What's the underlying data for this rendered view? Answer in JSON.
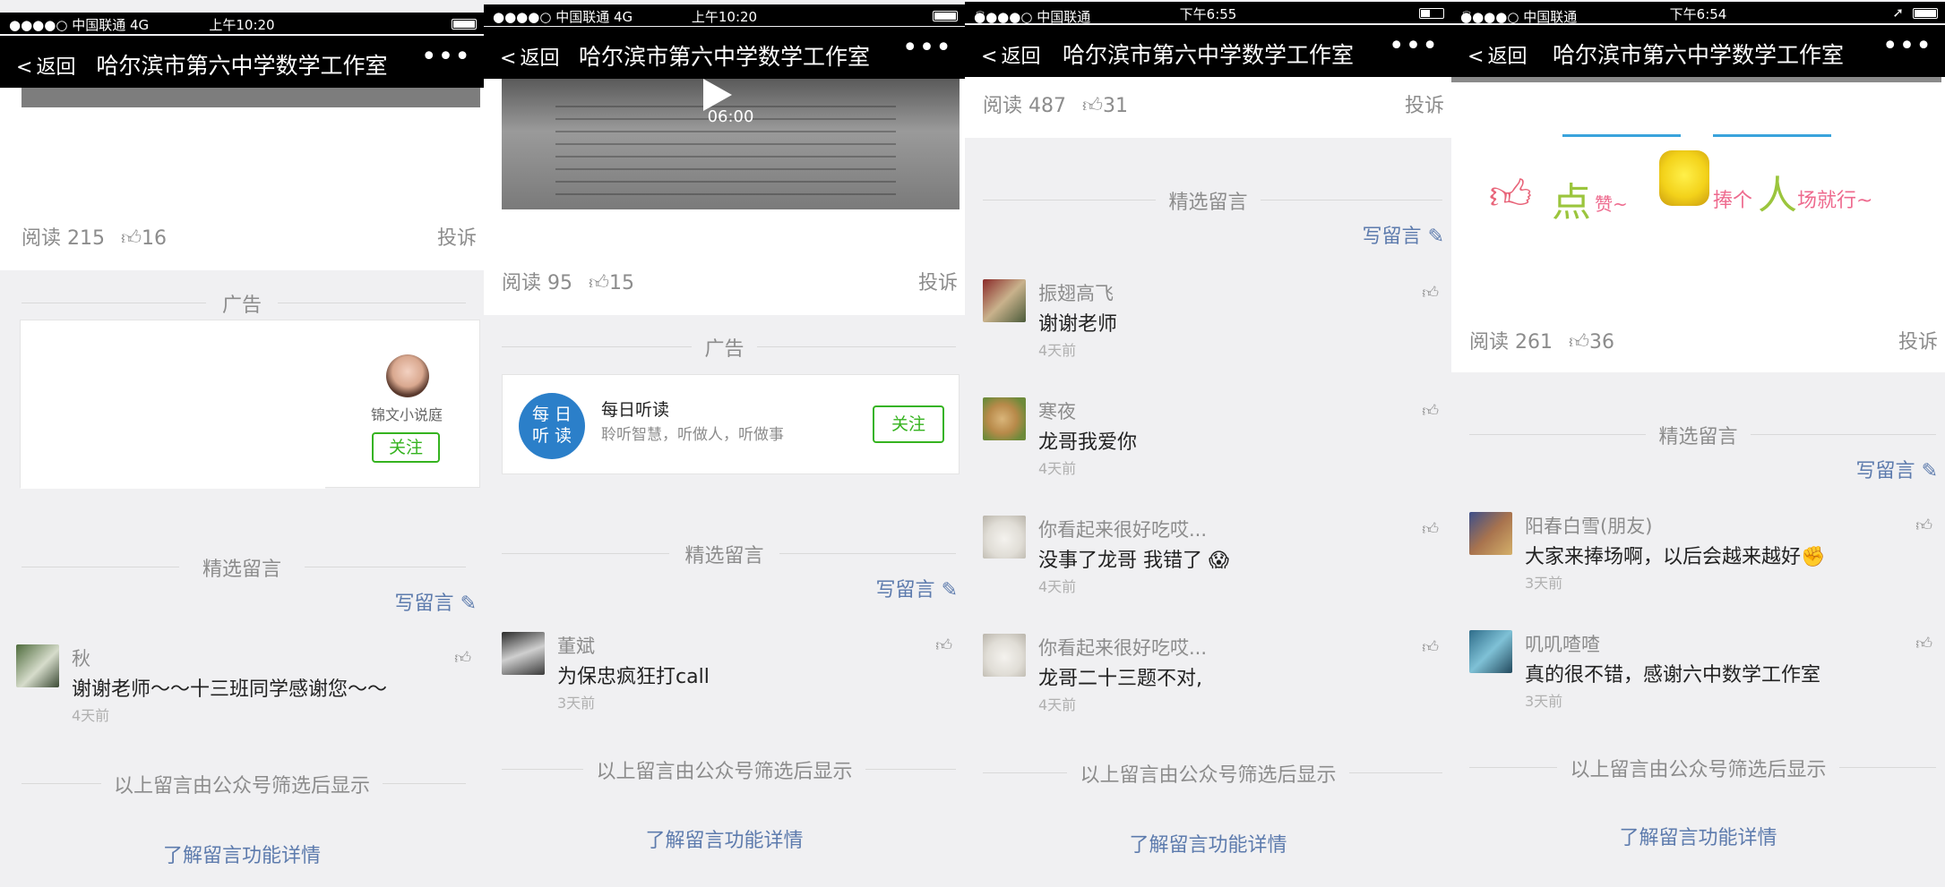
{
  "panels": [
    {
      "status": {
        "carrier": "●●●●○ 中国联通   4G",
        "time": "上午10:20"
      },
      "nav": {
        "back": "返回",
        "title": "哈尔滨市第六中学数学工作室",
        "more": "•••"
      },
      "reads": "阅读 215",
      "likes": "16",
      "complain": "投诉",
      "ad_label": "广告",
      "ad": {
        "name": "锦文小说庭",
        "follow": "关注"
      },
      "section": "精选留言",
      "write": "写留言",
      "comments": [
        {
          "name": "秋",
          "body": "谢谢老师～～十三班同学感谢您～～",
          "time": "4天前"
        }
      ],
      "footer": "以上留言由公众号筛选后显示",
      "learn": "了解留言功能详情"
    },
    {
      "status": {
        "carrier": "●●●●○ 中国联通   4G",
        "time": "上午10:20"
      },
      "nav": {
        "back": "返回",
        "title": "哈尔滨市第六中学数学工作室",
        "more": "•••"
      },
      "video_time": "06:00",
      "reads": "阅读 95",
      "likes": "15",
      "complain": "投诉",
      "ad_label": "广告",
      "ad": {
        "logo_top": "每 日",
        "logo_bottom": "听 读",
        "name": "每日听读",
        "desc": "聆听智慧，听做人，听做事",
        "follow": "关注"
      },
      "section": "精选留言",
      "write": "写留言",
      "comments": [
        {
          "name": "董斌",
          "body": "为保忠疯狂打call",
          "time": "3天前"
        }
      ],
      "footer": "以上留言由公众号筛选后显示",
      "learn": "了解留言功能详情"
    },
    {
      "status": {
        "carrier": "●●●●○ 中国联通",
        "time": "下午6:55"
      },
      "nav": {
        "back": "返回",
        "title": "哈尔滨市第六中学数学工作室",
        "more": "•••"
      },
      "reads": "阅读 487",
      "likes": "31",
      "complain": "投诉",
      "section": "精选留言",
      "write": "写留言",
      "comments": [
        {
          "name": "振翅高飞",
          "body": "谢谢老师",
          "time": "4天前"
        },
        {
          "name": "寒夜",
          "body": "龙哥我爱你",
          "time": "4天前"
        },
        {
          "name": "你看起来很好吃哎...",
          "body": "没事了龙哥 我错了 😱",
          "time": "4天前"
        },
        {
          "name": "你看起来很好吃哎...",
          "body": "龙哥二十三题不对,",
          "time": "4天前"
        }
      ],
      "footer": "以上留言由公众号筛选后显示",
      "learn": "了解留言功能详情"
    },
    {
      "status": {
        "carrier": "●●●●○ 中国联通",
        "time": "下午6:54"
      },
      "nav": {
        "back": "返回",
        "title": "哈尔滨市第六中学数学工作室",
        "more": "•••"
      },
      "banner": {
        "dian": "点",
        "zan": "赞~",
        "peng": "捧个",
        "ren": "人",
        "tail": "场就行~"
      },
      "reads": "阅读 261",
      "likes": "36",
      "complain": "投诉",
      "section": "精选留言",
      "write": "写留言",
      "comments": [
        {
          "name": "阳春白雪(朋友)",
          "body": "大家来捧场啊，以后会越来越好✊",
          "time": "3天前"
        },
        {
          "name": "叽叽喳喳",
          "body": "真的很不错，感谢六中数学工作室",
          "time": "3天前"
        }
      ],
      "footer": "以上留言由公众号筛选后显示",
      "learn": "了解留言功能详情"
    }
  ],
  "colors": {
    "link": "#5d7bad",
    "follow_green": "#35b31f",
    "nav_bg": "#000000",
    "page_bg": "#f0f0f2"
  }
}
